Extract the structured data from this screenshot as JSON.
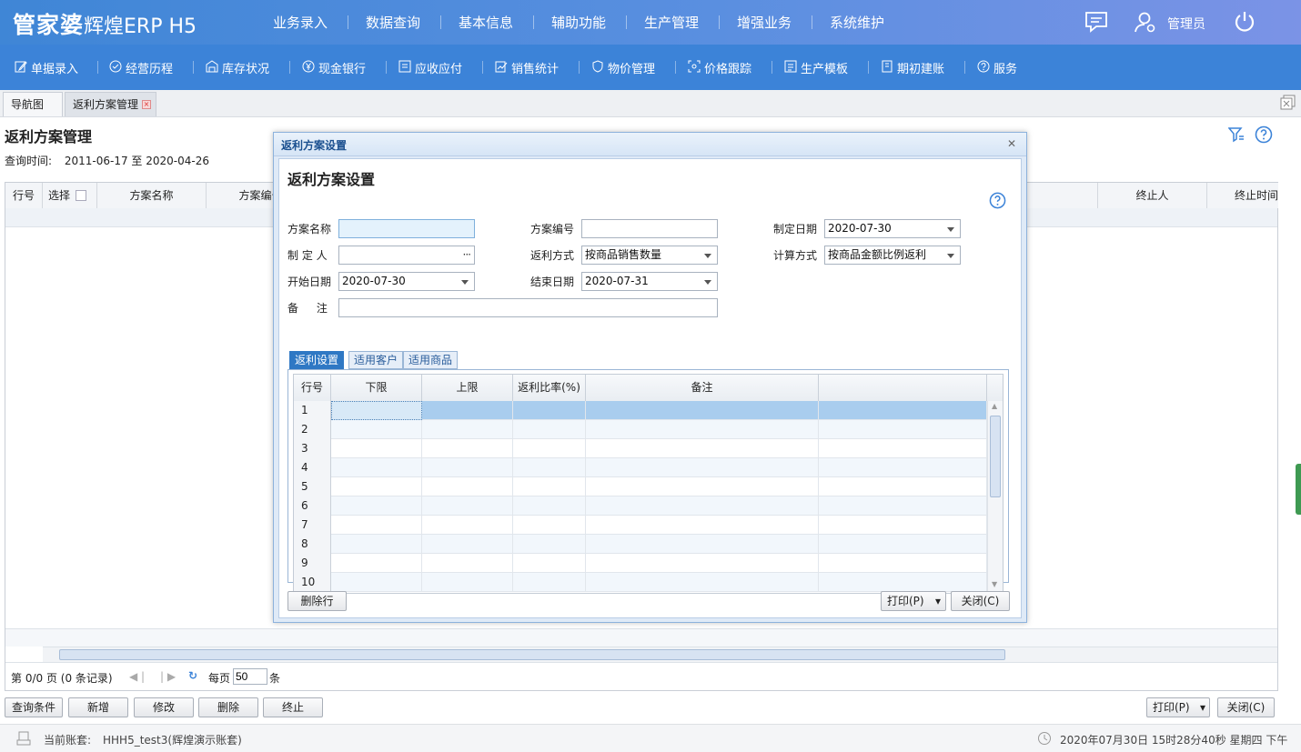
{
  "app": {
    "logo_main": "管家婆",
    "logo_sub": "辉煌ERP H5",
    "user": "管理员",
    "main_menu": [
      "业务录入",
      "数据查询",
      "基本信息",
      "辅助功能",
      "生产管理",
      "增强业务",
      "系统维护"
    ],
    "sub_menu": [
      "单据录入",
      "经营历程",
      "库存状况",
      "现金银行",
      "应收应付",
      "销售统计",
      "物价管理",
      "价格跟踪",
      "生产模板",
      "期初建账",
      "服务"
    ]
  },
  "tabs": [
    "导航图",
    "返利方案管理"
  ],
  "page": {
    "title": "返利方案管理",
    "query_label": "查询时间:",
    "query_value": "2011-06-17 至 2020-04-26",
    "grid_headers": [
      "行号",
      "选择",
      "方案名称",
      "方案编号",
      "终止人",
      "终止时间"
    ],
    "pager": {
      "info": "第 0/0 页 (0 条记录)",
      "per_page_label": "每页",
      "per_page_value": "50",
      "unit": "条"
    },
    "buttons": [
      "查询条件",
      "新增",
      "修改",
      "删除",
      "终止"
    ],
    "print": "打印(P)",
    "close": "关闭(C)"
  },
  "status": {
    "account_label": "当前账套:",
    "account_value": "HHH5_test3(辉煌演示账套)",
    "datetime": "2020年07月30日 15时28分40秒 星期四 下午"
  },
  "modal": {
    "window_title": "返利方案设置",
    "heading": "返利方案设置",
    "fields": {
      "name_label": "方案名称",
      "name_value": "",
      "code_label": "方案编号",
      "code_value": "",
      "make_date_label": "制定日期",
      "make_date_value": "2020-07-30",
      "maker_label": "制 定 人",
      "maker_value": "",
      "mode_label": "返利方式",
      "mode_value": "按商品销售数量",
      "calc_label": "计算方式",
      "calc_value": "按商品金额比例返利",
      "start_label": "开始日期",
      "start_value": "2020-07-30",
      "end_label": "结束日期",
      "end_value": "2020-07-31",
      "remark_label": "备 注",
      "remark_value": ""
    },
    "detail_tabs": [
      "返利设置",
      "适用客户",
      "适用商品"
    ],
    "grid_headers": [
      "行号",
      "下限",
      "上限",
      "返利比率(%)",
      "备注"
    ],
    "rows": [
      "1",
      "2",
      "3",
      "4",
      "5",
      "6",
      "7",
      "8",
      "9",
      "10"
    ],
    "delete_row": "删除行",
    "print": "打印(P)",
    "close": "关闭(C)"
  }
}
